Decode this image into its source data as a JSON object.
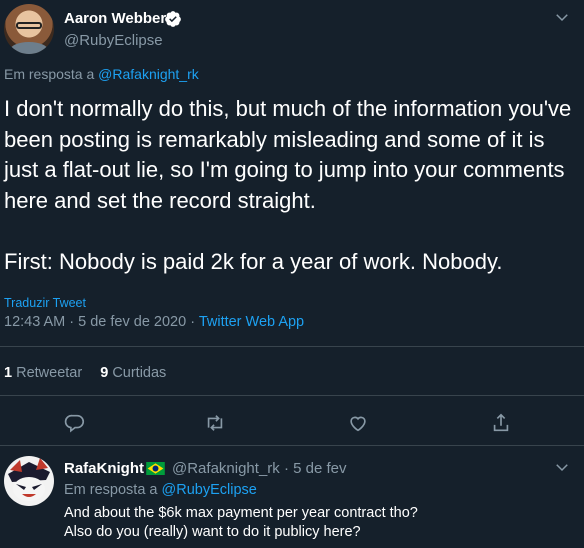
{
  "tweet": {
    "author_name": "Aaron Webber",
    "handle": "@RubyEclipse",
    "reply_prefix": "Em resposta a ",
    "reply_to": "@Rafaknight_rk",
    "text": "I don't normally do this, but much of the information you've been posting is remarkably misleading and some of it is just a flat-out lie, so I'm going to jump into your comments here and set the record straight.\n\nFirst: Nobody is paid 2k for a year of work. Nobody.",
    "translate_label": "Traduzir Tweet",
    "timestamp": "12:43 AM · 5 de fev de 2020 · ",
    "source": "Twitter Web App",
    "retweets_count": "1",
    "retweets_label": "Retweetar",
    "likes_count": "9",
    "likes_label": "Curtidas",
    "icons": {
      "verified": "verified-badge-icon",
      "more": "chevron-down-icon",
      "reply": "reply-icon",
      "retweet": "retweet-icon",
      "like": "heart-icon",
      "share": "share-icon"
    }
  },
  "reply": {
    "author_name": "RafaKnight",
    "flag": "brazil-flag-icon",
    "handle_time": "@Rafaknight_rk · 5 de fev",
    "reply_prefix": "Em resposta a ",
    "reply_to": "@RubyEclipse",
    "text": "And about the $6k max payment per year contract tho?\nAlso do you (really) want to do it publicy here?"
  },
  "colors": {
    "background": "#15202b",
    "accent": "#1da1f2",
    "muted": "#8899a6",
    "border": "#38444d"
  }
}
